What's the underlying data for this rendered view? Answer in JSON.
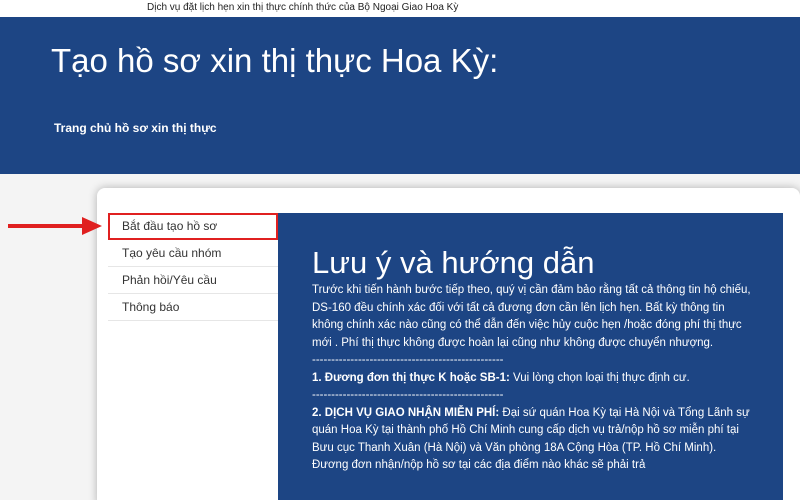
{
  "top_bar": {
    "text": "Dịch vụ đặt lịch hẹn xin thị thực chính thức của Bộ Ngoại Giao Hoa Kỳ"
  },
  "header": {
    "title": "Tạo hồ sơ xin thị thực Hoa Kỳ:",
    "breadcrumb": "Trang chủ hồ sơ xin thị thực"
  },
  "sidebar": {
    "items": [
      {
        "label": "Bắt đầu tạo hồ sơ",
        "active": true
      },
      {
        "label": "Tạo yêu cầu nhóm"
      },
      {
        "label": "Phản hồi/Yêu cầu"
      },
      {
        "label": "Thông báo"
      }
    ]
  },
  "content": {
    "title": "Lưu ý và hướng dẫn",
    "intro": "Trước khi tiến hành bước tiếp theo, quý vị cần đảm bảo rằng tất cả thông tin hộ chiếu, DS-160 đều chính xác đối với tất cả đương đơn cần lên lịch hẹn. Bất kỳ thông tin không chính xác nào cũng có thể dẫn đến việc hủy cuộc hẹn /hoặc đóng phí thị thực mới . Phí thị thực không được hoàn lại cũng như không được chuyển nhượng.",
    "separator": "--------------------------------------------------",
    "item1_heading": "1. Đương đơn thị thực K hoặc SB-1:",
    "item1_text": " Vui lòng chọn loại thị thực định cư.",
    "item2_heading": "2. DỊCH VỤ GIAO NHẬN MIỄN PHÍ:",
    "item2_text": " Đại sứ quán Hoa Kỳ tại Hà Nội và Tổng Lãnh sự quán Hoa Kỳ tại thành phố Hồ Chí Minh cung cấp dịch vụ trả/nộp hồ sơ miễn phí tại Bưu cục Thanh Xuân (Hà Nội) và Văn phòng 18A Cộng Hòa (TP. Hồ Chí Minh). Đương đơn nhận/nộp hồ sơ tại các địa điểm nào khác sẽ phải trả"
  },
  "colors": {
    "brand_navy": "#1d4584",
    "highlight_red": "#e02020"
  }
}
